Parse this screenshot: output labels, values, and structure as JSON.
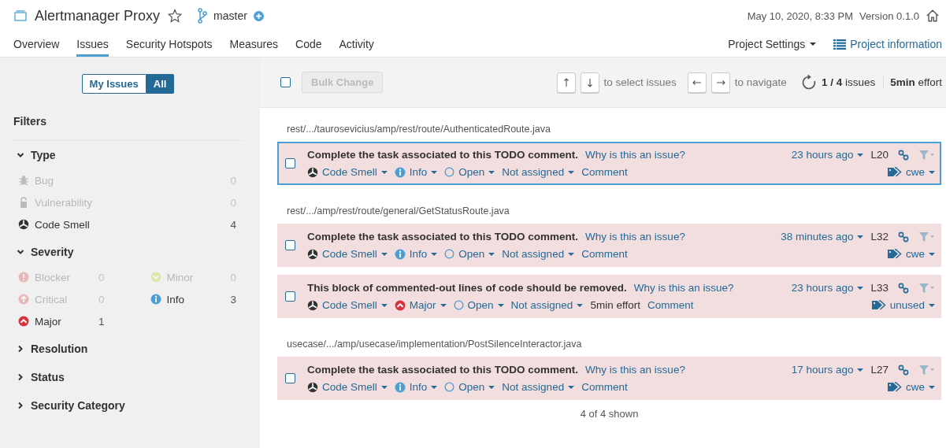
{
  "header": {
    "project": "Alertmanager Proxy",
    "starred": false,
    "branch": "master",
    "date": "May 10, 2020, 8:33 PM",
    "version": "Version 0.1.0"
  },
  "nav": [
    {
      "label": "Overview",
      "selected": false
    },
    {
      "label": "Issues",
      "selected": true
    },
    {
      "label": "Security Hotspots",
      "selected": false
    },
    {
      "label": "Measures",
      "selected": false
    },
    {
      "label": "Code",
      "selected": false
    },
    {
      "label": "Activity",
      "selected": false
    }
  ],
  "nav_actions": {
    "settings": "Project Settings",
    "information": "Project information"
  },
  "sidebar": {
    "toggle": [
      {
        "label": "My Issues",
        "selected": false
      },
      {
        "label": "All",
        "selected": true
      }
    ],
    "title": "Filters",
    "facets": [
      {
        "title": "Type",
        "expanded": true,
        "kind": "list",
        "items": [
          {
            "kind": "bug",
            "label": "Bug",
            "count": "0",
            "disabled": true
          },
          {
            "kind": "vulnerability",
            "label": "Vulnerability",
            "count": "0",
            "disabled": true
          },
          {
            "kind": "code_smell",
            "label": "Code Smell",
            "count": "4",
            "disabled": false
          }
        ]
      },
      {
        "title": "Severity",
        "expanded": true,
        "kind": "grid",
        "items": [
          {
            "kind": "blocker",
            "label": "Blocker",
            "count": "0",
            "disabled": true
          },
          {
            "kind": "minor",
            "label": "Minor",
            "count": "0",
            "disabled": true
          },
          {
            "kind": "critical",
            "label": "Critical",
            "count": "0",
            "disabled": true
          },
          {
            "kind": "info",
            "label": "Info",
            "count": "3",
            "disabled": false
          },
          {
            "kind": "major",
            "label": "Major",
            "count": "1",
            "disabled": false
          }
        ]
      },
      {
        "title": "Resolution",
        "expanded": false
      },
      {
        "title": "Status",
        "expanded": false
      },
      {
        "title": "Security Category",
        "expanded": false
      }
    ]
  },
  "toolbar": {
    "select_all": {
      "checked": false
    },
    "bulk_change": {
      "label": "Bulk Change",
      "disabled": true
    },
    "select_hint": "to select issues",
    "navigate_hint": "to navigate",
    "counter": "**1 / 4** issues",
    "effort": "**5min** effort"
  },
  "groups": [
    {
      "file": "rest/.../taurosevicius/amp/rest/route/AuthenticatedRoute.java",
      "issues": [
        {
          "focused": true,
          "checked": false,
          "message": "Complete the task associated to this TODO comment.",
          "why": "Why is this an issue?",
          "time": "23 hours ago",
          "line": "L20",
          "type": {
            "kind": "code_smell",
            "label": "Code Smell"
          },
          "severity": {
            "kind": "info",
            "label": "Info"
          },
          "status": "Open",
          "assignee": "Not assigned",
          "comment": "Comment",
          "tag": "cwe"
        }
      ]
    },
    {
      "file": "rest/.../amp/rest/route/general/GetStatusRoute.java",
      "issues": [
        {
          "focused": false,
          "checked": false,
          "message": "Complete the task associated to this TODO comment.",
          "why": "Why is this an issue?",
          "time": "38 minutes ago",
          "line": "L32",
          "type": {
            "kind": "code_smell",
            "label": "Code Smell"
          },
          "severity": {
            "kind": "info",
            "label": "Info"
          },
          "status": "Open",
          "assignee": "Not assigned",
          "comment": "Comment",
          "tag": "cwe"
        },
        {
          "focused": false,
          "checked": false,
          "message": "This block of commented-out lines of code should be removed.",
          "why": "Why is this an issue?",
          "time": "23 hours ago",
          "line": "L33",
          "type": {
            "kind": "code_smell",
            "label": "Code Smell"
          },
          "severity": {
            "kind": "major",
            "label": "Major"
          },
          "status": "Open",
          "assignee": "Not assigned",
          "effort": "5min effort",
          "comment": "Comment",
          "tag": "unused"
        }
      ]
    },
    {
      "file": "usecase/.../amp/usecase/implementation/PostSilenceInteractor.java",
      "issues": [
        {
          "focused": false,
          "checked": false,
          "message": "Complete the task associated to this TODO comment.",
          "why": "Why is this an issue?",
          "time": "17 hours ago",
          "line": "L27",
          "type": {
            "kind": "code_smell",
            "label": "Code Smell"
          },
          "severity": {
            "kind": "info",
            "label": "Info"
          },
          "status": "Open",
          "assignee": "Not assigned",
          "comment": "Comment",
          "tag": "cwe"
        }
      ]
    }
  ],
  "footer": "4 of 4 shown"
}
